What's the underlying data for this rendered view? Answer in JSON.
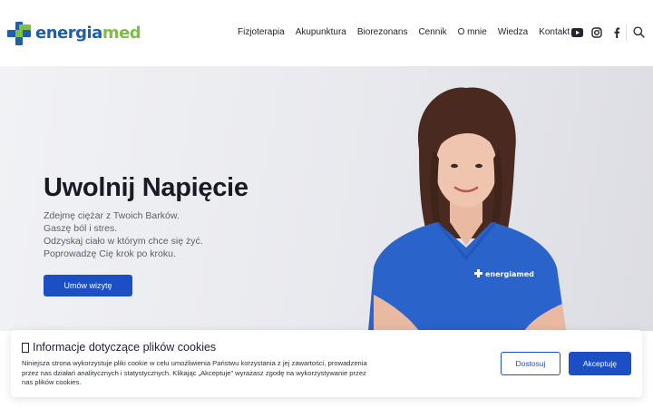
{
  "header": {
    "logo": {
      "part1": "energia",
      "part2": "med"
    },
    "nav": [
      "Fizjoterapia",
      "Akupunktura",
      "Biorezonans",
      "Cennik",
      "O mnie",
      "Wiedza",
      "Kontakt"
    ],
    "socials": [
      "youtube-icon",
      "instagram-icon",
      "facebook-icon"
    ],
    "search_icon": "search-icon"
  },
  "hero": {
    "title": "Uwolnij Napięcie",
    "lines": [
      "Zdejmę ciężar z Twoich Barków.",
      "Gaszę ból i stres.",
      "Odzyskaj ciało w którym chce się żyć.",
      "Poprowadzę Cię krok po kroku."
    ],
    "cta": "Umów wizytę",
    "shirt_logo": "energiamed"
  },
  "cookie": {
    "title": "Informacje dotyczące plików cookies",
    "text": "Niniejsza strona wykorzystuje pliki cookie w celu umożliwienia Państwu korzystania z jej zawartości, prowadzenia przez nas działań analitycznych i statystycznych. Klikając „Akceptuje” wyrażasz zgodę na wykorzystywanie przez nas plików cookies.",
    "customize": "Dostosuj",
    "accept": "Akceptuję"
  },
  "colors": {
    "brand_blue": "#1d5fa8",
    "brand_green": "#7bc043",
    "button_blue": "#1d4fc4",
    "shirt_blue": "#2a63c9"
  }
}
